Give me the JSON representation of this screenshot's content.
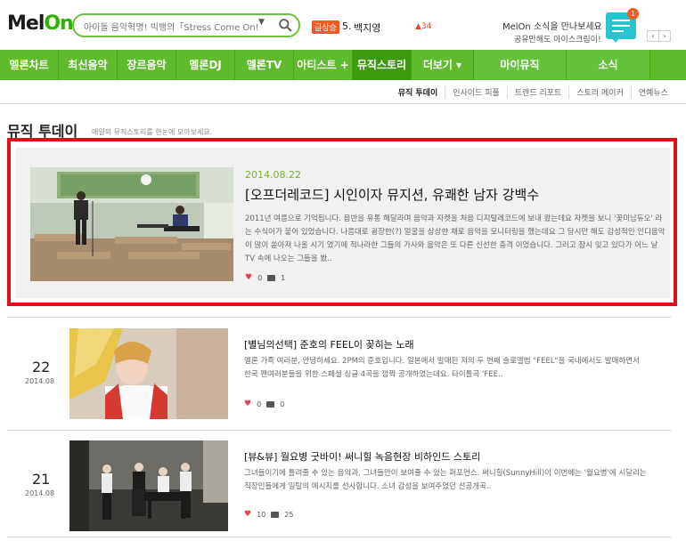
{
  "header": {
    "logo_main": "Mel",
    "logo_accent": "On",
    "search_placeholder": "아이돌 음악혁명! 빅뱅의「Stress Come On!」",
    "search_dropdown": "▼",
    "rank_badge": "급상승",
    "rank_number": "5.",
    "rank_artist": "백지영",
    "rank_change": "34",
    "notice_line1": "MelOn 소식을 만나보세요",
    "notice_line2": "공유만해도 아이스크림이!",
    "notification_count": "1",
    "prev_arrow": "‹",
    "next_arrow": "›"
  },
  "gnb": [
    {
      "label": "멜론차트",
      "width": 66
    },
    {
      "label": "최신음악",
      "width": 66
    },
    {
      "label": "장르음악",
      "width": 66
    },
    {
      "label": "멜론DJ",
      "width": 66
    },
    {
      "label": "멜론TV",
      "width": 66
    },
    {
      "label": "아티스트 +",
      "width": 66
    },
    {
      "label": "뮤직스토리",
      "width": 66
    },
    {
      "label": "더보기 ▾",
      "width": 70
    },
    {
      "label": "마이뮤직",
      "width": 104
    },
    {
      "label": "소식",
      "width": 94
    }
  ],
  "submenu": [
    "뮤직 투데이",
    "인사이드 피플",
    "트렌드 리포트",
    "스토리 메이커",
    "연예뉴스"
  ],
  "page": {
    "title": "뮤직 투데이",
    "description": "매일의 뮤직스토리를 한눈에 모아보세요."
  },
  "featured": {
    "date": "2014.08.22",
    "title": "[오프더레코드] 시인이자 뮤지션, 유쾌한 남자 강백수",
    "body": "2011년 여름으로 기억됩니다. 음반을 유통 해달라며 음악과 자켓을 처음 디지털레코드에 보내 왔는데요 자켓을 보니 '꽃미남듀오' 라는 수식어가 붙어 있었습니다. 나름대로 굉장한(?) 얼굴을 상상한 채로 음악을 모니터링을 했는데요 그 당시만 해도 감성적인 인디음악이 많이 쏟아져 나올 시기 였기에 적나라한 그들의 가사와 음악은 또 다른 신선한 충격 이었습니다. 그러고 잠시 잊고 있다가 어느 날 TV 속에 나오는 그들을 봤..",
    "likes": "0",
    "comments": "1",
    "colors": {
      "border": "#e0101b",
      "date": "#7ab02d"
    }
  },
  "items": [
    {
      "day": "22",
      "month": "2014.08",
      "title": "[별님의선택] 준호의 FEEL이 꽂히는 노래",
      "body": "멜론 가족 여러분, 안녕하세요. 2PM의 준호입니다. 일본에서 발매된 저의 두 번째 솔로앨범 \"FEEL\"을 국내에서도 발매하면서 한국 팬여러분들을 위한 스페셜 싱글 4곡을 깜짝 공개하였는데요. 타이틀곡 'FEE..",
      "likes": "0",
      "comments": "0"
    },
    {
      "day": "21",
      "month": "2014.08",
      "title": "[뷰&뷰] 월요병 굿바이! 써니힐 녹음현장 비하인드 스토리",
      "body": "그녀들이기에 틀려줄 수 있는 음악과, 그녀들만이 보여줄 수 있는 퍼포먼스. 써니힐(SunnyHill)이 이번에는 '월요병'에 시달리는 직장인들에게 일탈의 메시지를 선사합니다. 소녀 감성을 보여주었던 선공개곡..",
      "likes": "10",
      "comments": "25"
    }
  ],
  "colors": {
    "brand_green": "#5fbb2e",
    "active_menu": "#3b9a0d",
    "accent_orange": "#f35a22"
  }
}
